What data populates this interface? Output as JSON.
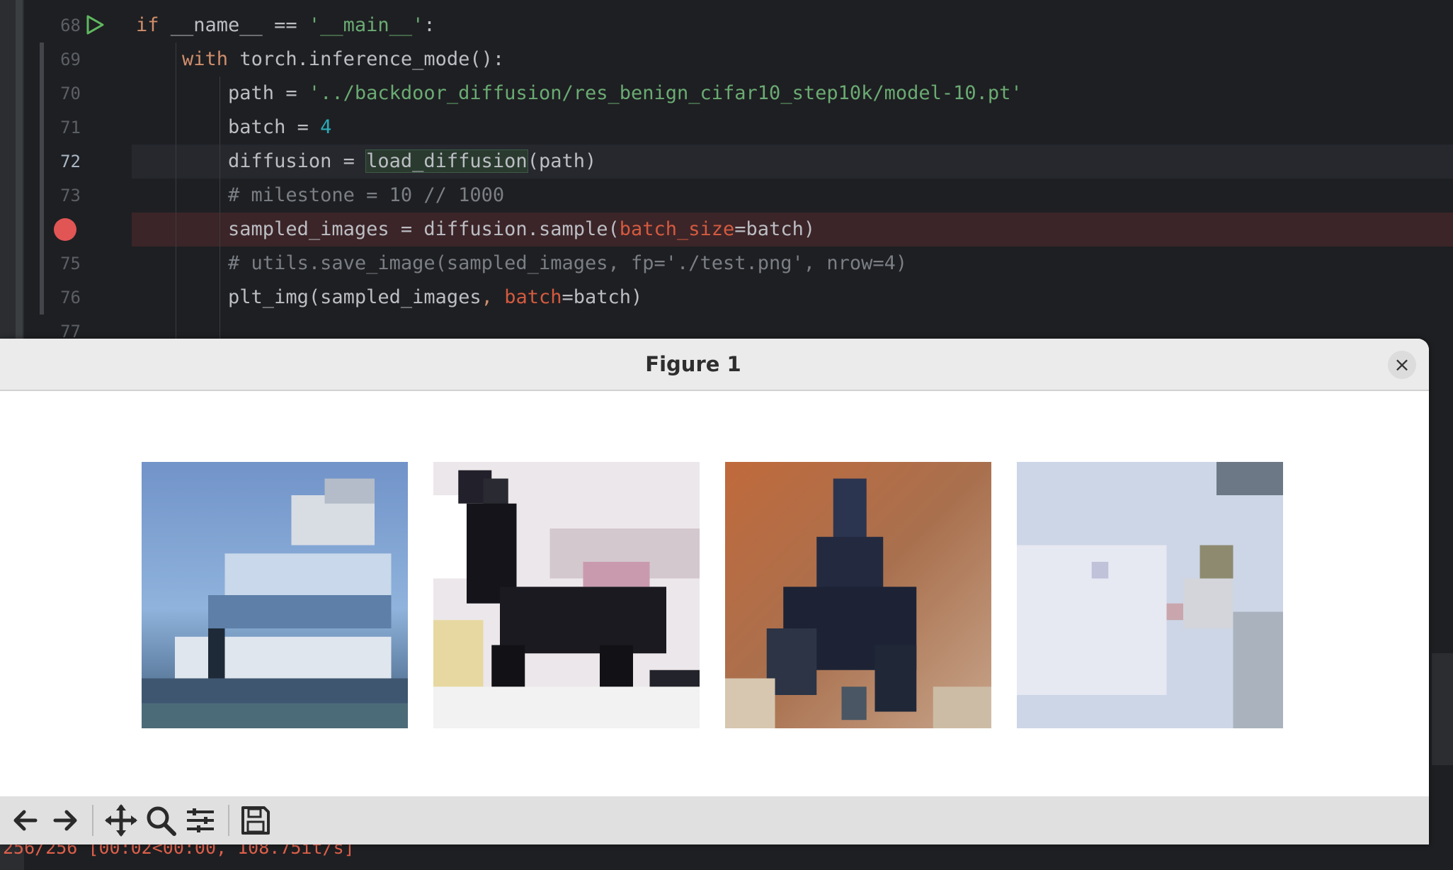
{
  "editor": {
    "lines": [
      {
        "num": "68",
        "tokens": [
          {
            "t": "if",
            "c": "kw"
          },
          {
            "t": " __name__ == "
          },
          {
            "t": "'__main__'",
            "c": "str"
          },
          {
            "t": ":"
          }
        ]
      },
      {
        "num": "69",
        "tokens": [
          {
            "t": "    "
          },
          {
            "t": "with",
            "c": "kw"
          },
          {
            "t": " torch.inference_mode():"
          }
        ]
      },
      {
        "num": "70",
        "tokens": [
          {
            "t": "        path = "
          },
          {
            "t": "'../backdoor_diffusion/res_benign_cifar10_step10k/model-10.pt'",
            "c": "str"
          }
        ]
      },
      {
        "num": "71",
        "tokens": [
          {
            "t": "        batch = "
          },
          {
            "t": "4",
            "c": "num"
          }
        ]
      },
      {
        "num": "72",
        "tokens": [
          {
            "t": "        diffusion = "
          },
          {
            "t": "load_diffusion",
            "c": "fnhl"
          },
          {
            "t": "(path)"
          }
        ]
      },
      {
        "num": "73",
        "tokens": [
          {
            "t": "        # milestone = 10 // 1000",
            "c": "cmt"
          }
        ]
      },
      {
        "num": "",
        "tokens": [
          {
            "t": "        sampled_images = diffusion.sample("
          },
          {
            "t": "batch_size",
            "c": "param"
          },
          {
            "t": "=batch)"
          }
        ]
      },
      {
        "num": "75",
        "tokens": [
          {
            "t": "        # utils.save_image(sampled_images, fp='./test.png', nrow=4)",
            "c": "cmt"
          }
        ]
      },
      {
        "num": "76",
        "tokens": [
          {
            "t": "        plt_img(sampled_images"
          },
          {
            "t": ", ",
            "c": "kw"
          },
          {
            "t": "batch",
            "c": "param"
          },
          {
            "t": "=batch)"
          }
        ]
      },
      {
        "num": "77",
        "tokens": []
      }
    ],
    "current_line": "72",
    "console_text": "256/256 [00:02<00:00, 108.75it/s]",
    "colors": {
      "background": "#1e1f22",
      "breakpoint": "#e25555",
      "keyword": "#cf8e6d",
      "string": "#6aab73"
    }
  },
  "figure": {
    "title": "Figure 1",
    "close_icon": "close-icon",
    "samples": [
      "sample-ship",
      "sample-dog",
      "sample-bird",
      "sample-white"
    ],
    "toolbar": [
      "back-icon",
      "forward-icon",
      "pan-icon",
      "zoom-icon",
      "configure-subplots-icon",
      "save-icon"
    ]
  }
}
